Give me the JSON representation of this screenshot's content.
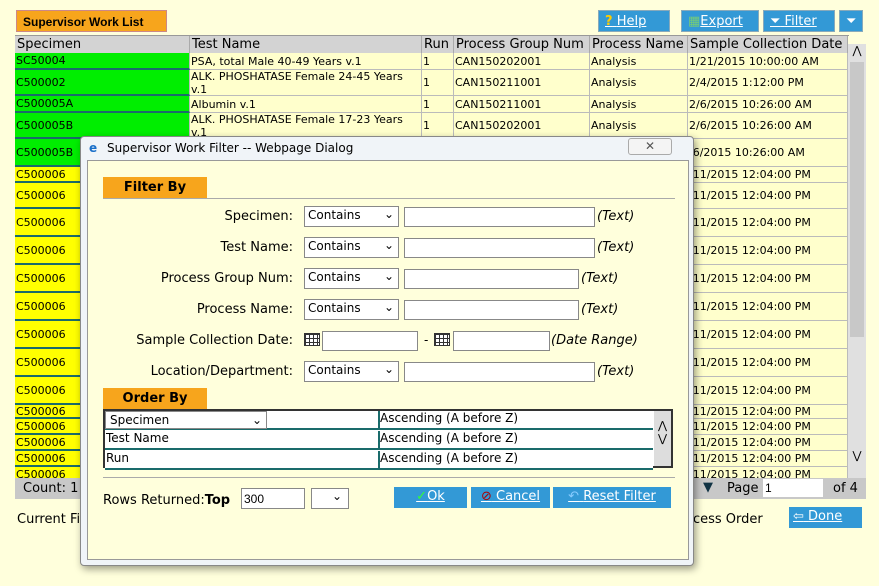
{
  "page": {
    "title": "Supervisor Work List",
    "help": "Help",
    "export": "Export",
    "filter": "Filter",
    "count": "Count: 1",
    "page_label": "Page",
    "page_value": "1",
    "page_of": "of 4",
    "current_filter": "Current Fi",
    "process_order": "ocess Order",
    "done": "Done"
  },
  "table": {
    "columns": [
      "Specimen",
      "Test Name",
      "Run",
      "Process Group Num",
      "Process Name",
      "Sample Collection Date"
    ],
    "rows": [
      {
        "specimen": "SC50004",
        "test": "PSA, total Male 40-49 Years v.1",
        "run": "1",
        "pgn": "CAN150202001",
        "pn": "Analysis",
        "date": "1/21/2015 10:00:00 AM",
        "status": "green"
      },
      {
        "specimen": "C500002",
        "test": "ALK. PHOSHATASE Female 24-45 Years v.1",
        "run": "1",
        "pgn": "CAN150211001",
        "pn": "Analysis",
        "date": "2/4/2015 1:12:00 PM",
        "status": "green"
      },
      {
        "specimen": "C500005A",
        "test": "Albumin v.1",
        "run": "1",
        "pgn": "CAN150211001",
        "pn": "Analysis",
        "date": "2/6/2015 10:26:00 AM",
        "status": "green"
      },
      {
        "specimen": "C500005B",
        "test": "ALK. PHOSHATASE Female 17-23 Years v.1",
        "run": "1",
        "pgn": "CAN150202001",
        "pn": "Analysis",
        "date": "2/6/2015 10:26:00 AM",
        "status": "green"
      },
      {
        "specimen": "C500005B",
        "test": "",
        "run": "",
        "pgn": "",
        "pn": "",
        "date": "/6/2015 10:26:00 AM",
        "status": "green"
      },
      {
        "specimen": "C500006",
        "date": "/11/2015 12:04:00 PM",
        "status": "yellow"
      },
      {
        "specimen": "C500006",
        "date": "/11/2015 12:04:00 PM",
        "status": "yellow"
      },
      {
        "specimen": "C500006",
        "date": "/11/2015 12:04:00 PM",
        "status": "yellow"
      },
      {
        "specimen": "C500006",
        "date": "/11/2015 12:04:00 PM",
        "status": "yellow"
      },
      {
        "specimen": "C500006",
        "date": "/11/2015 12:04:00 PM",
        "status": "yellow"
      },
      {
        "specimen": "C500006",
        "date": "/11/2015 12:04:00 PM",
        "status": "yellow"
      },
      {
        "specimen": "C500006",
        "date": "/11/2015 12:04:00 PM",
        "status": "yellow"
      },
      {
        "specimen": "C500006",
        "date": "/11/2015 12:04:00 PM",
        "status": "yellow"
      },
      {
        "specimen": "C500006",
        "date": "/11/2015 12:04:00 PM",
        "status": "yellow"
      },
      {
        "specimen": "C500006",
        "date": "/11/2015 12:04:00 PM",
        "status": "yellow"
      },
      {
        "specimen": "C500006",
        "date": "/11/2015 12:04:00 PM",
        "status": "yellow"
      },
      {
        "specimen": "C500006",
        "date": "/11/2015 12:04:00 PM",
        "status": "yellow"
      },
      {
        "specimen": "C500006",
        "date": "/11/2015 12:04:00 PM",
        "status": "yellow"
      },
      {
        "specimen": "C500006",
        "date": "/11/2015 12:04:00 PM",
        "status": "yellow"
      }
    ]
  },
  "dialog": {
    "title": "Supervisor Work Filter -- Webpage Dialog",
    "filter_by": "Filter By",
    "fields": [
      {
        "label": "Specimen:",
        "op": "Contains",
        "value": "",
        "hint": "(Text)"
      },
      {
        "label": "Test Name:",
        "op": "Contains",
        "value": "",
        "hint": "(Text)"
      },
      {
        "label": "Process Group Num:",
        "op": "Contains",
        "value": "",
        "hint": "(Text)"
      },
      {
        "label": "Process Name:",
        "op": "Contains",
        "value": "",
        "hint": "(Text)"
      },
      {
        "label": "Sample Collection Date:",
        "from": "",
        "dash": "-",
        "to": "",
        "hint": "(Date Range)"
      },
      {
        "label": "Location/Department:",
        "op": "Contains",
        "value": "",
        "hint": "(Text)"
      }
    ],
    "order_by": "Order By",
    "order_rows": [
      {
        "field": "Specimen",
        "dir": "Ascending (A before Z)"
      },
      {
        "field": "Test Name",
        "dir": "Ascending (A before Z)"
      },
      {
        "field": "Run",
        "dir": "Ascending (A before Z)"
      }
    ],
    "rows_returned": "Rows Returned:",
    "top": "Top",
    "top_value": "300",
    "ok": "Ok",
    "cancel": "Cancel",
    "reset": "Reset Filter"
  },
  "colors": {
    "accent": "#3399d6",
    "tab": "#f7a51c",
    "green": "#00ee00",
    "yellow": "#ffff00",
    "row": "#ffffcc"
  }
}
